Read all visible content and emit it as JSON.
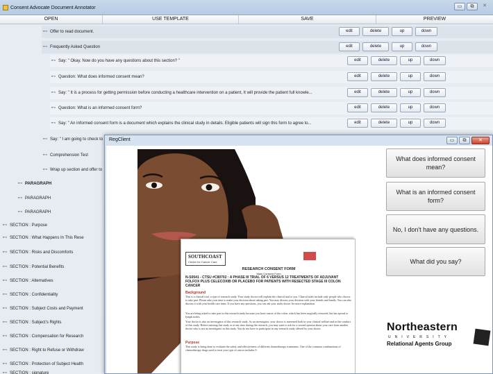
{
  "window": {
    "title": "Consent Advocate Document Annotator"
  },
  "menu": [
    "OPEN",
    "USE TEMPLATE",
    "SAVE",
    "PREVIEW"
  ],
  "row_buttons": {
    "edit": "edit",
    "delete": "delete",
    "up": "up",
    "down": "down"
  },
  "tree": {
    "rows": [
      {
        "label": "Offer to read document.",
        "has_buttons": true
      },
      {
        "label": "Frequently Asked Question",
        "has_buttons": true
      },
      {
        "label": "Say: \" Okay. Now do you have any questions about this section? \"",
        "has_buttons": true
      },
      {
        "label": "Question:  What does informed consent mean?",
        "has_buttons": true
      },
      {
        "label": "Say: \" It is a process for getting permission before conducting a healthcare intervention on a patient, It will provide the patient full knowle...",
        "has_buttons": true
      },
      {
        "label": "Question:  What is an informed consent form?",
        "has_buttons": true
      },
      {
        "label": "Say: \" An informed consent form is a document which explains the clinical study in details. Eligible patients will sign this form to agree to...",
        "has_buttons": true
      },
      {
        "label": "Say: \" I am going to check to",
        "has_buttons": false
      },
      {
        "label": "Comprehension Test",
        "has_buttons": false
      },
      {
        "label": "Wrap up section and offer to",
        "has_buttons": false
      },
      {
        "label": "PARAGRAPH",
        "has_buttons": false
      },
      {
        "label": "PARAGRAPH",
        "has_buttons": false
      },
      {
        "label": "PARAGRAPH",
        "has_buttons": false
      },
      {
        "label": "SECTION : Purpose",
        "has_buttons": false
      },
      {
        "label": "SECTION : What Happens In This Rese",
        "has_buttons": false
      },
      {
        "label": "SECTION : Risks and Discomforts",
        "has_buttons": false
      },
      {
        "label": "SECTION : Potential Benefits",
        "has_buttons": false
      },
      {
        "label": "SECTION : Alternatives",
        "has_buttons": false
      },
      {
        "label": "SECTION : Confidentiality",
        "has_buttons": false
      },
      {
        "label": "SECTION : Subject Costs and Payment",
        "has_buttons": false
      },
      {
        "label": "SECTION : Subject's Rights",
        "has_buttons": false
      },
      {
        "label": "SECTION : Compensation for Research",
        "has_buttons": false
      },
      {
        "label": "SECTION : Right to Refuse or Withdraw",
        "has_buttons": false
      },
      {
        "label": "SECTION : Protection of Subject Health",
        "has_buttons": false
      },
      {
        "label": "SECTION : signature",
        "has_buttons": false
      }
    ]
  },
  "regclient": {
    "title": "RegClient",
    "options": [
      "What does informed consent mean?",
      "What is an informed consent form?",
      "No, I don't have any questions.",
      "What did you say?"
    ],
    "document": {
      "logo": "SOUTHCOAST",
      "logo_sub": "Center for Cancer Care",
      "form_title": "RESEARCH CONSENT FORM",
      "form_sub": "Main Consent Form",
      "study": "N-S0541 - CTSU #C80702 : A PHASE III TRIAL OF 6 VERSUS 12 TREATMENTS OF ADJUVANT FOLFOX PLUS CELECOXIB OR PLACEBO FOR PATIENTS WITH RESECTED STAGE III COLON CANCER",
      "h_background": "Background",
      "p_background": "This is a clinical trial, a type of research study. Your study doctor will explain the clinical trial to you. Clinical trials include only people who choose to take part. Please take your time to make your decision about taking part. You may discuss your decision with your friends and family. You can also discuss it with your health care team. If you have any questions, you can ask your study doctor for more explanation.",
      "p_asked": "You are being asked to take part in this research study because you have cancer of the colon, which has been surgically removed, but has spread to lymph nodes.",
      "p_doctor": "Your doctor is also an investigator of this research study. As an investigator, your doctor is interested both in your clinical welfare and in the conduct of this study. Before entering this study or at any time during the research, you may want to ask for a second opinion about your care from another doctor who is not an investigator in this study. You do not have to participate in any research study offered by your doctor.",
      "h_purpose": "Purpose",
      "p_purpose": "This study is being done to evaluate the safety and effectiveness of different chemotherapy treatments. One of the common combinations of chemotherapy drugs used to treat your type of cancer includes 5-"
    },
    "brand": {
      "name": "Northeastern",
      "university": "UNIVERSITY",
      "group": "Relational Agents Group"
    }
  }
}
